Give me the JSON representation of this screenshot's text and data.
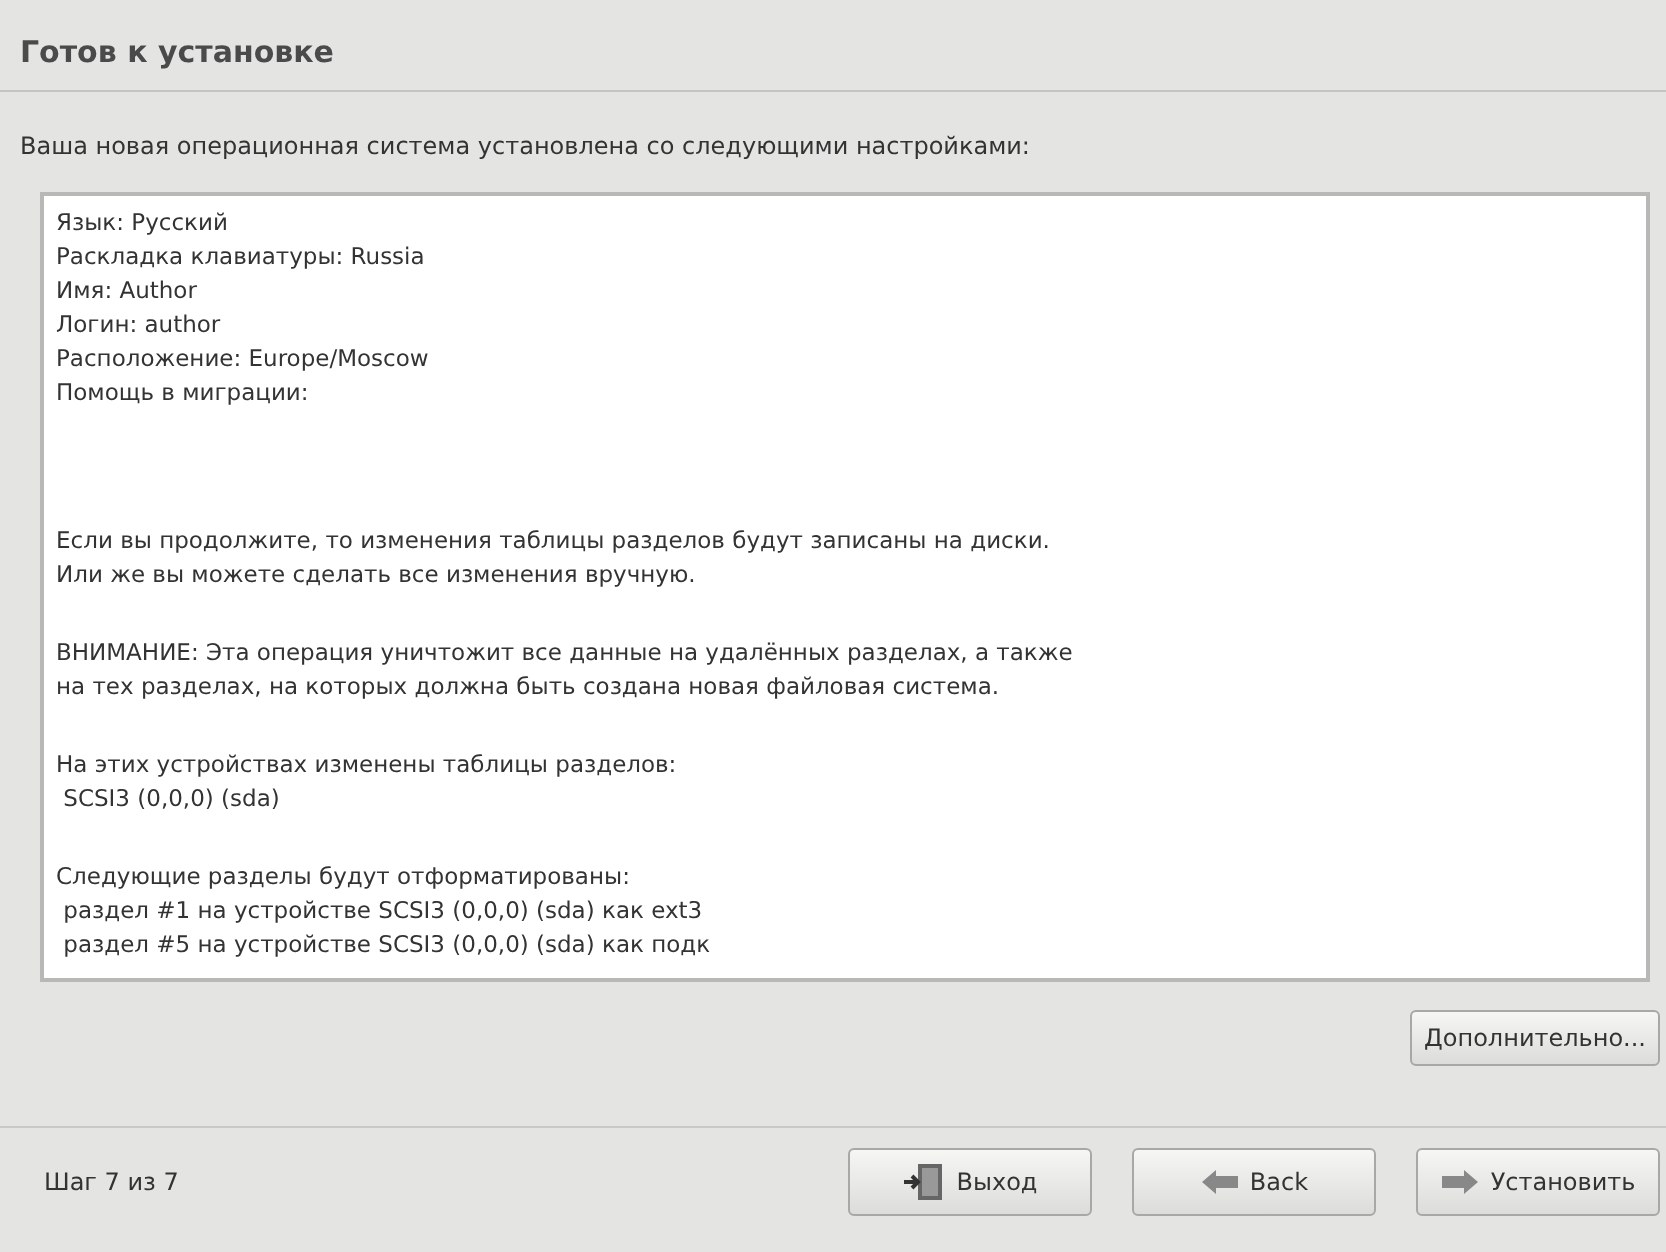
{
  "title": "Готов к установке",
  "subtitle": "Ваша новая операционная система установлена со следующими настройками:",
  "summary_blocks": [
    {
      "lines": [
        "Язык: Русский",
        "Раскладка клавиатуры: Russia",
        "Имя: Author",
        "Логин: author",
        "Расположение: Europe/Moscow",
        "Помощь в миграции:"
      ]
    },
    {
      "lines": [
        "Если вы продолжите, то изменения таблицы разделов будут записаны на диски.",
        "Или же вы можете сделать все изменения вручную."
      ]
    },
    {
      "lines": [
        "ВНИМАНИЕ: Эта операция уничтожит все данные на удалённых разделах, а также",
        "на тех разделах, на которых должна быть создана новая файловая система."
      ]
    },
    {
      "lines": [
        "На этих устройствах изменены таблицы разделов:",
        " SCSI3 (0,0,0) (sda)"
      ]
    },
    {
      "lines": [
        "Следующие разделы будут отформатированы:",
        " раздел #1 на устройстве SCSI3 (0,0,0) (sda) как ext3",
        " раздел #5 на устройстве SCSI3 (0,0,0) (sda) как подк"
      ]
    }
  ],
  "advanced_button": "Дополнительно...",
  "step": "Шаг 7 из 7",
  "buttons": [
    {
      "kind": "quit",
      "label": "Выход"
    },
    {
      "kind": "back",
      "label": "Back"
    },
    {
      "kind": "forward",
      "label": "Установить"
    }
  ]
}
